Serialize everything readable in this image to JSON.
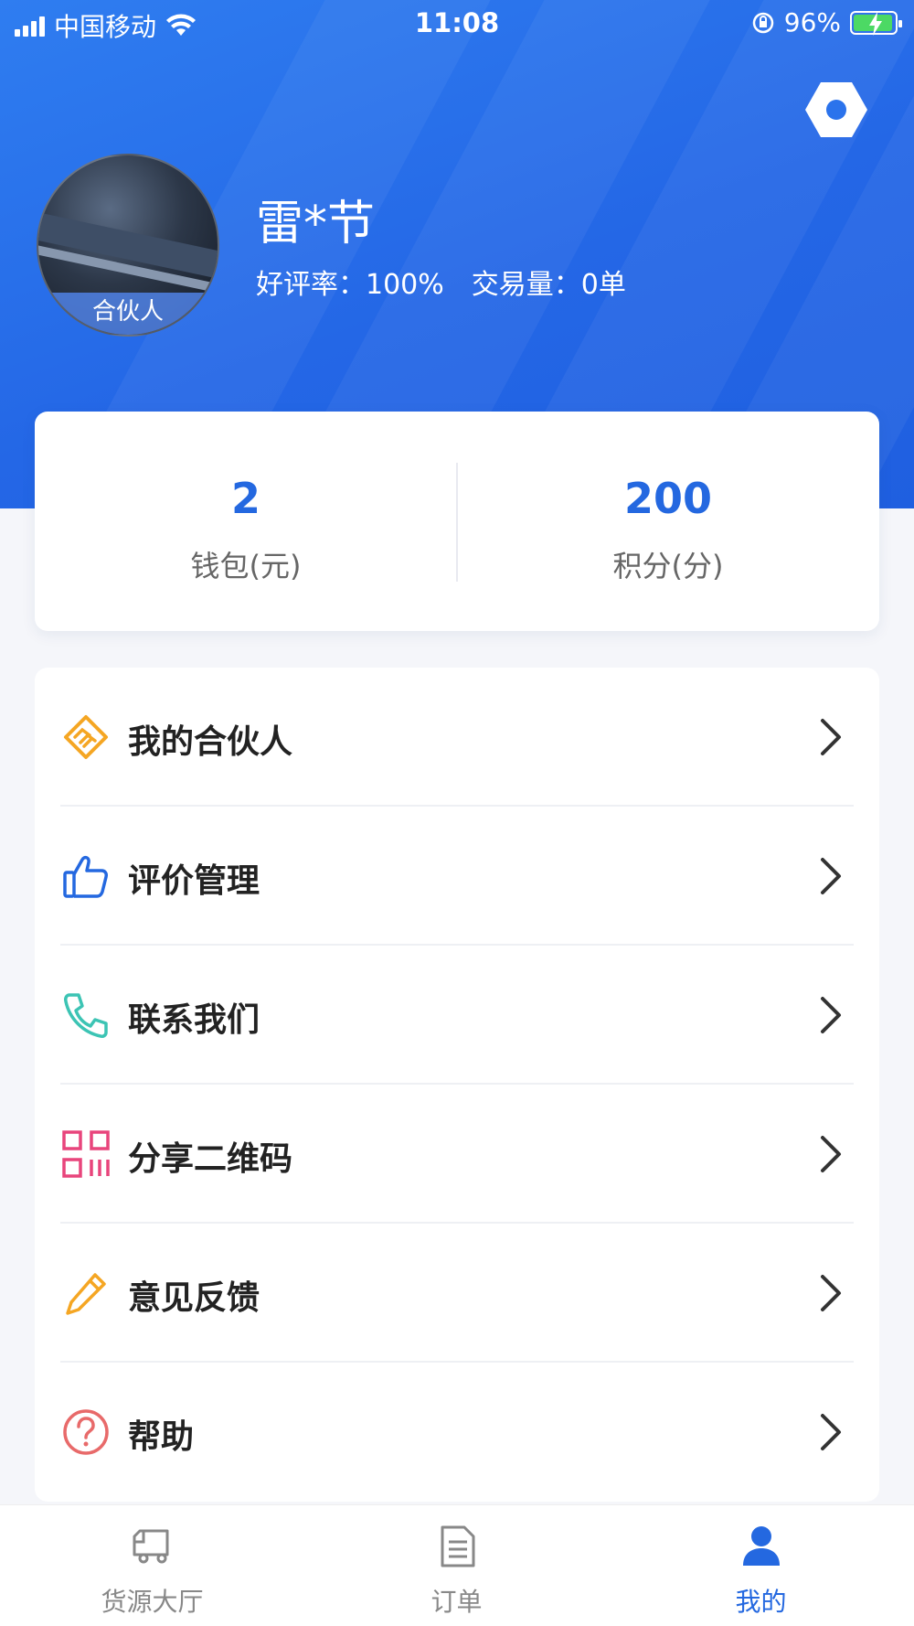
{
  "status_bar": {
    "carrier": "中国移动",
    "time": "11:08",
    "battery": "96%",
    "icons": [
      "signal-icon",
      "wifi-icon",
      "orientation-lock-icon",
      "battery-charging-icon"
    ]
  },
  "header": {
    "settings_icon": "gear-icon"
  },
  "profile": {
    "name": "雷*节",
    "badge": "合伙人",
    "rating": "好评率：100%",
    "volume": "交易量：0单"
  },
  "wallet": {
    "wallet_value": "2",
    "wallet_label": "钱包(元)",
    "points_value": "200",
    "points_label": "积分(分)"
  },
  "menu": {
    "items": [
      {
        "label": "我的合伙人",
        "icon": "handshake-icon",
        "color": "#f5a623"
      },
      {
        "label": "评价管理",
        "icon": "thumbs-up-icon",
        "color": "#2468e0"
      },
      {
        "label": "联系我们",
        "icon": "phone-icon",
        "color": "#3cc4b4"
      },
      {
        "label": "分享二维码",
        "icon": "qr-code-icon",
        "color": "#e8457c"
      },
      {
        "label": "意见反馈",
        "icon": "pencil-icon",
        "color": "#f5a623"
      },
      {
        "label": "帮助",
        "icon": "help-icon",
        "color": "#e86a6a"
      }
    ]
  },
  "tabbar": {
    "tabs": [
      {
        "label": "货源大厅",
        "icon": "truck-icon",
        "active": false
      },
      {
        "label": "订单",
        "icon": "document-icon",
        "active": false
      },
      {
        "label": "我的",
        "icon": "user-icon",
        "active": true
      }
    ]
  },
  "colors": {
    "primary": "#2468e0",
    "header_bg": "#2b73ec"
  }
}
